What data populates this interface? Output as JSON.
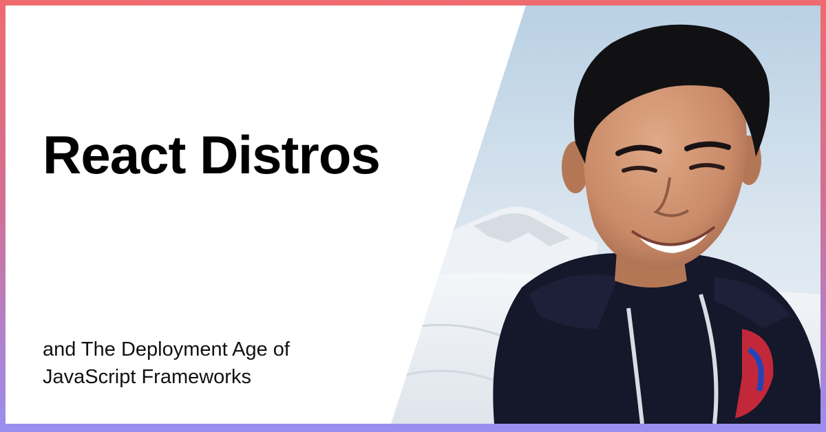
{
  "title": "React Distros",
  "subtitle": {
    "line1": "and The Deployment Age of",
    "line2": "JavaScript Frameworks"
  },
  "photo": {
    "subject": "speaker-portrait",
    "setting": "snowy mountain landscape"
  },
  "colors": {
    "border_top": "#ee6b6f",
    "border_bottom": "#9a8ef0",
    "card_background": "#ffffff",
    "title_text": "#000000",
    "sky": "#c9dbe9",
    "hoodie": "#15172b"
  }
}
